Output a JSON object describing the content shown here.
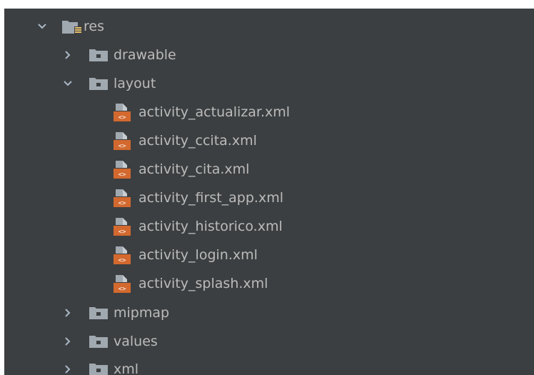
{
  "tree": {
    "root": {
      "label": "res",
      "expanded": true,
      "icon": "resource-folder-icon"
    },
    "items": [
      {
        "label": "drawable",
        "expanded": false,
        "icon": "package-folder-icon"
      },
      {
        "label": "layout",
        "expanded": true,
        "icon": "package-folder-icon",
        "children": [
          {
            "label": "activity_actualizar.xml",
            "icon": "layout-xml-file-icon"
          },
          {
            "label": "activity_ccita.xml",
            "icon": "layout-xml-file-icon"
          },
          {
            "label": "activity_cita.xml",
            "icon": "layout-xml-file-icon"
          },
          {
            "label": "activity_first_app.xml",
            "icon": "layout-xml-file-icon"
          },
          {
            "label": "activity_historico.xml",
            "icon": "layout-xml-file-icon"
          },
          {
            "label": "activity_login.xml",
            "icon": "layout-xml-file-icon"
          },
          {
            "label": "activity_splash.xml",
            "icon": "layout-xml-file-icon"
          }
        ]
      },
      {
        "label": "mipmap",
        "expanded": false,
        "icon": "package-folder-icon"
      },
      {
        "label": "values",
        "expanded": false,
        "icon": "package-folder-icon"
      },
      {
        "label": "xml",
        "expanded": false,
        "icon": "package-folder-icon"
      }
    ]
  },
  "colors": {
    "background": "#3c3f41",
    "text": "#bbbbbb",
    "arrow": "#a9b7c6",
    "folder": "#a0a8b0",
    "xml_badge": "#d3692e"
  }
}
